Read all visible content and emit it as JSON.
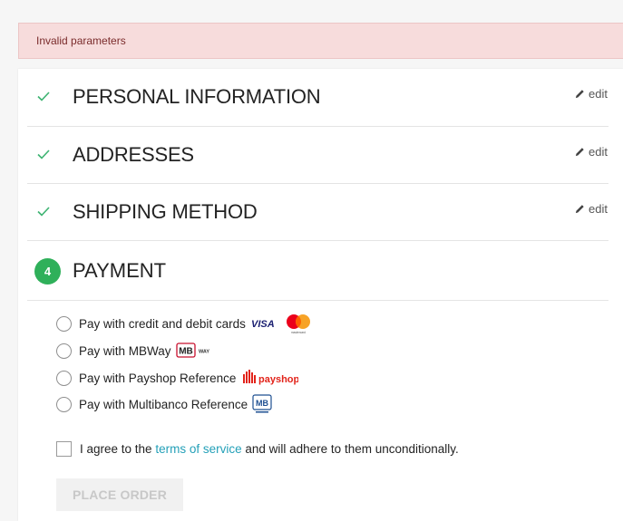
{
  "alert": {
    "text": "Invalid parameters"
  },
  "steps": [
    {
      "title": "PERSONAL INFORMATION",
      "edit_label": "edit"
    },
    {
      "title": "ADDRESSES",
      "edit_label": "edit"
    },
    {
      "title": "SHIPPING METHOD",
      "edit_label": "edit"
    }
  ],
  "payment": {
    "step_number": "4",
    "title": "PAYMENT",
    "options": [
      {
        "label": "Pay with credit and debit cards",
        "logos": [
          "VISA",
          "mastercard"
        ]
      },
      {
        "label": "Pay with MBWay",
        "logos": [
          "MB",
          "WAY"
        ]
      },
      {
        "label": "Pay with Payshop Reference",
        "logos": [
          "payshop"
        ]
      },
      {
        "label": "Pay with Multibanco Reference",
        "logos": [
          "MB"
        ]
      }
    ]
  },
  "terms": {
    "prefix": "I agree to the",
    "link": "terms of service",
    "suffix": "and will adhere to them unconditionally."
  },
  "place_order": {
    "label": "PLACE ORDER"
  },
  "colors": {
    "check": "#3cb371",
    "badge": "#2fb05a",
    "link": "#24a0b8",
    "alert_bg": "#f7dcdc",
    "visa": "#1a1f71",
    "mastercard_red": "#eb001b",
    "mastercard_yellow": "#f79e1b",
    "mb_red": "#c8102e",
    "mb_blue": "#1d4f91"
  }
}
